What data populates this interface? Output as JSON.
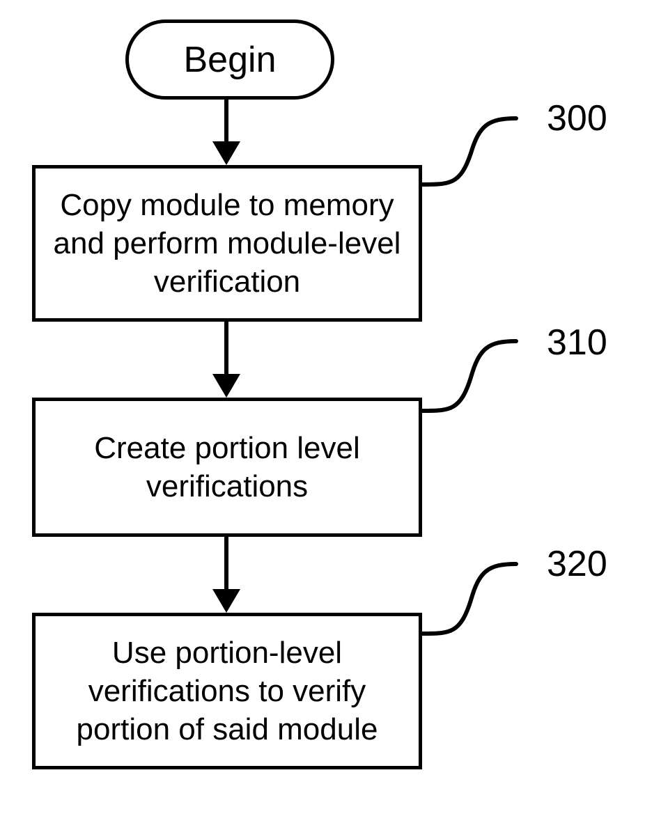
{
  "flowchart": {
    "begin": "Begin",
    "steps": [
      {
        "text": "Copy module to memory and perform module-level verification",
        "label": "300"
      },
      {
        "text": "Create portion level verifications",
        "label": "310"
      },
      {
        "text": "Use portion-level verifications to verify portion of said module",
        "label": "320"
      }
    ]
  }
}
